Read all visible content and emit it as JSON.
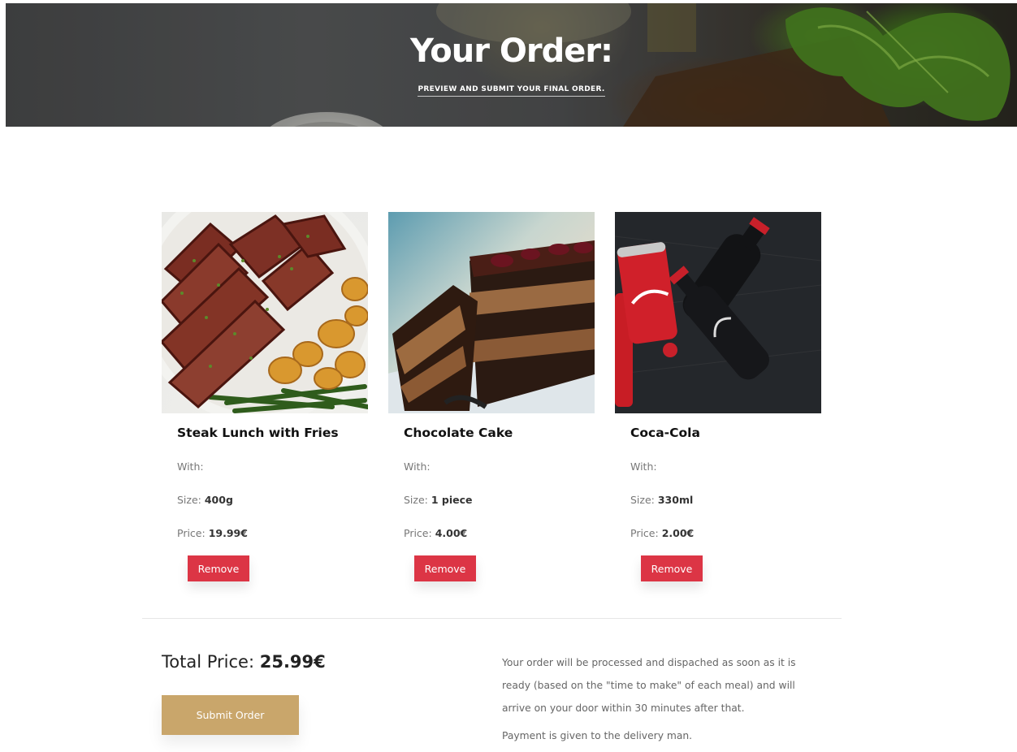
{
  "hero": {
    "title": "Your Order:",
    "subtitle": "PREVIEW AND SUBMIT YOUR FINAL ORDER."
  },
  "items": [
    {
      "name": "Steak Lunch with Fries",
      "with_label": "With:",
      "size_label": "Size:",
      "size_value": "400g",
      "price_label": "Price:",
      "price_value": "19.99€",
      "remove_label": "Remove"
    },
    {
      "name": "Chocolate Cake",
      "with_label": "With:",
      "size_label": "Size:",
      "size_value": "1 piece",
      "price_label": "Price:",
      "price_value": "4.00€",
      "remove_label": "Remove"
    },
    {
      "name": "Coca-Cola",
      "with_label": "With:",
      "size_label": "Size:",
      "size_value": "330ml",
      "price_label": "Price:",
      "price_value": "2.00€",
      "remove_label": "Remove"
    }
  ],
  "summary": {
    "total_label": "Total Price:",
    "total_value": "25.99€",
    "submit_label": "Submit Order",
    "info_paragraph_1": "Your order will be processed and dispached as soon as it is ready (based on the \"time to make\" of each meal) and will arrive on your door within 30 minutes after that.",
    "info_paragraph_2": "Payment is given to the delivery man."
  },
  "colors": {
    "remove_button": "#dc3545",
    "submit_button": "#c9a66b"
  }
}
